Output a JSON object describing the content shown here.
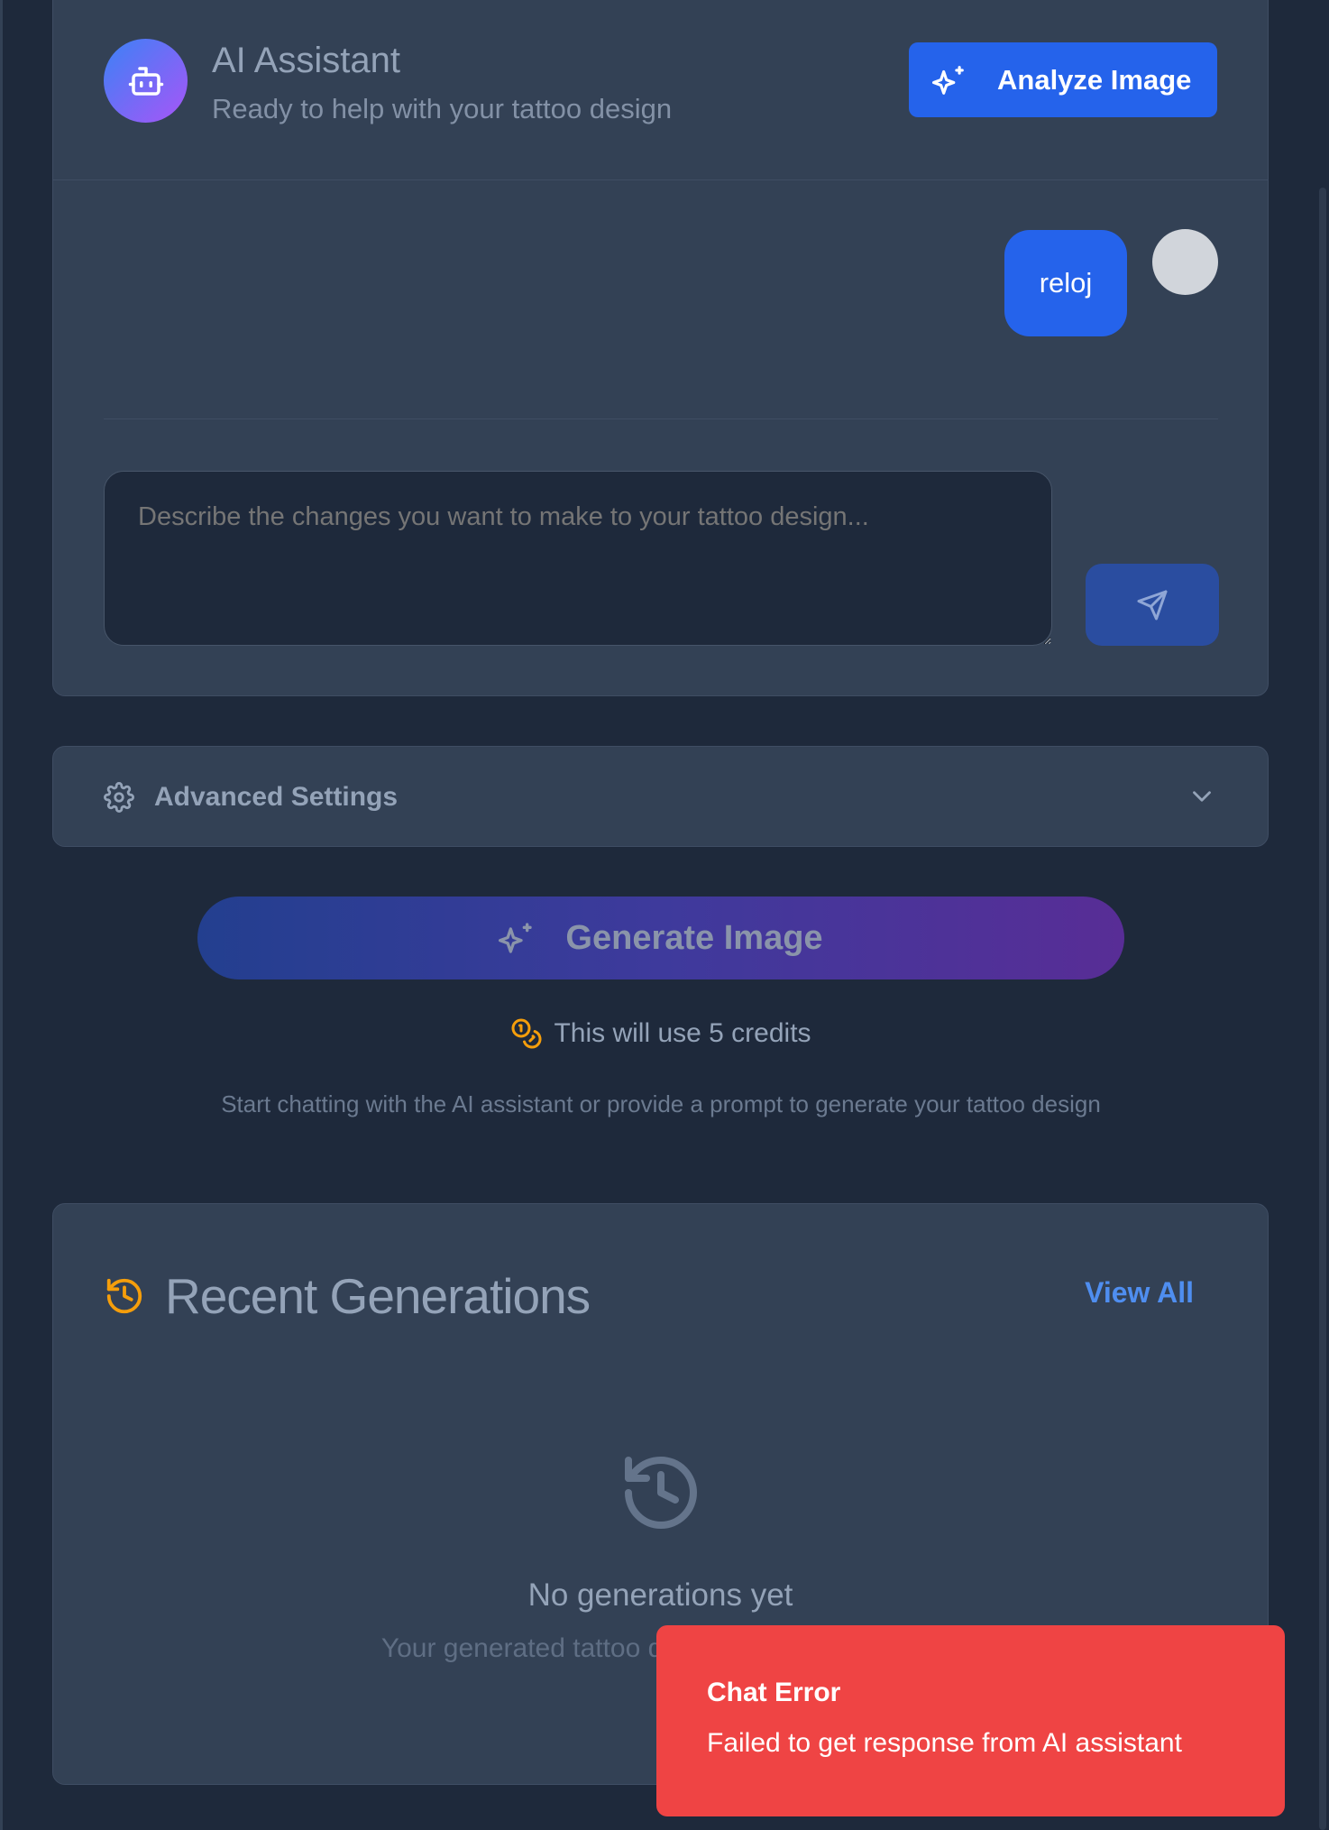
{
  "header": {
    "title": "AI Assistant",
    "subtitle": "Ready to help with your tattoo design",
    "analyze_label": "Analyze Image"
  },
  "chat": {
    "messages": [
      {
        "role": "user",
        "text": "reloj"
      }
    ],
    "input_placeholder": "Describe the changes you want to make to your tattoo design..."
  },
  "settings": {
    "label": "Advanced Settings"
  },
  "generate": {
    "label": "Generate Image",
    "credits_text": "This will use 5 credits",
    "hint": "Start chatting with the AI assistant or provide a prompt to generate your tattoo design"
  },
  "recent": {
    "title": "Recent Generations",
    "view_all": "View All",
    "empty_title": "No generations yet",
    "empty_subtitle": "Your generated tattoo designs will appear here"
  },
  "toast": {
    "title": "Chat Error",
    "message": "Failed to get response from AI assistant"
  },
  "colors": {
    "background": "#1e293b",
    "card": "#334155",
    "primary": "#2563eb",
    "accent_orange": "#f59e0b",
    "link": "#4f8ef0",
    "error": "#ef4444"
  },
  "icons": [
    "bot-icon",
    "sparkles-icon",
    "send-icon",
    "gear-icon",
    "chevron-down-icon",
    "coins-icon",
    "history-icon"
  ]
}
